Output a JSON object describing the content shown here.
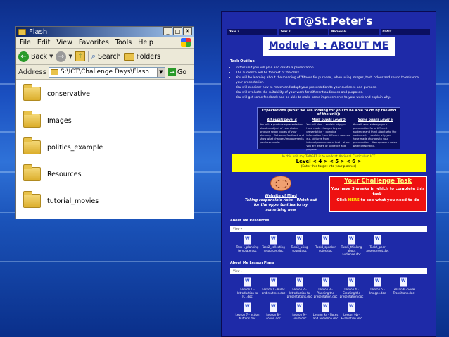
{
  "explorer": {
    "title": "Flash",
    "window_buttons": [
      "_",
      "□",
      "X"
    ],
    "menu": [
      "File",
      "Edit",
      "View",
      "Favorites",
      "Tools",
      "Help"
    ],
    "toolbar": {
      "back": "Back",
      "search": "Search",
      "folders": "Folders"
    },
    "address": {
      "label": "Address",
      "path": "S:\\ICT\\Challenge Days\\Flash",
      "go": "Go"
    },
    "files": [
      {
        "name": "conservative",
        "icon": "folder-icon"
      },
      {
        "name": "Images",
        "icon": "folder-icon"
      },
      {
        "name": "politics_example",
        "icon": "folder-icon"
      },
      {
        "name": "Resources",
        "icon": "folder-icon"
      },
      {
        "name": "tutorial_movies",
        "icon": "folder-icon"
      }
    ]
  },
  "webpage": {
    "title": "ICT@St.Peter's",
    "nav": [
      "Year 7",
      "Year 8",
      "Nationals",
      "CLAIT"
    ],
    "heading": "Module 1 : ABOUT ME",
    "task_outline_label": "Task Outline",
    "bullets": [
      "In this unit you will plan and create a presentation.",
      "The audience will be the rest of the class.",
      "You will be learning about the meaning of 'fitness for purpose', when using images, text, colour and sound to enhance your presentation.",
      "You will consider how to match and adapt your presentation to your audience and purpose.",
      "You will evaluate the suitability of your work for different audiences and purposes.",
      "You will get some feedback and be able to make some improvements to your work and explain why."
    ],
    "expectations": {
      "title": "Expectations  (What we are looking for you to be able to do by the end of the unit):",
      "columns": [
        {
          "head": "All pupils Level 4",
          "text": "You will: • produce a presentation about a subject of your choice • produce rough copies of your planning • Get some feedback and show what changes/improvements you have made."
        },
        {
          "head": "Most pupils Level 5",
          "text": "You will also: • explain why you have made changes to your presentation • combine information from different sources e.g. pictures from internet/scanners and text • show you are aware of audience and purpose."
        },
        {
          "head": "Some pupils Level 6",
          "text": "You will also: • design your presentation for a different audience and think about who the audience is • explain why you have made changes to your presentation • Use speakers notes when presenting."
        }
      ]
    },
    "target": {
      "line1": "In this unit my TARGET is to work at National Curriculum ICT",
      "line2": "Level < 4 > < 5 > < 6 >",
      "line3": "(Enter this target into your planner)"
    },
    "wow": {
      "label": "Website of Mind",
      "tagline": "Taking responsible risks - Watch out for the opportunities to try something new"
    },
    "challenge": {
      "title": "Your Challenge Task",
      "line": "You have 3 weeks in which to complete this task.",
      "click_pre": "Click ",
      "here": "HERE",
      "click_post": " to see what you need to do"
    },
    "resources_label": "About Me Resources",
    "resources_header": "View ▾",
    "resources": [
      "Task 1_planning template.doc",
      "Task2_collecting resources.doc",
      "Task3_using sound.doc",
      "Task4_speaker notes.doc",
      "Task5_thinking about audience.doc",
      "Task6_peer assessment.doc"
    ],
    "lesson_label": "About Me Lesson Plans",
    "lesson_header": "View ▾",
    "lessons": [
      "Lesson 1 - Introduction to ICT.doc",
      "Lesson 1 - Rules and routines.doc",
      "Lesson 2 - Introduction to presentations.doc",
      "Lesson 3 - Planning the presentation.doc",
      "Lesson 4 - Creating the presentation.doc",
      "Lesson 5 - Images.doc",
      "Lesson 6 - Slide Transitions.doc",
      "Lesson 7 - action buttons.doc",
      "Lesson 8 - sound.doc",
      "Lesson 9 - Finish.doc",
      "Lesson 9a - Notes and audience.doc",
      "Lesson 9b - Evaluation.doc"
    ]
  },
  "colors": {
    "desktop": "#1a4fc0",
    "page_bg": "#1e2aa8",
    "target_bg": "#ffff00",
    "challenge_bg": "#ee1111"
  }
}
